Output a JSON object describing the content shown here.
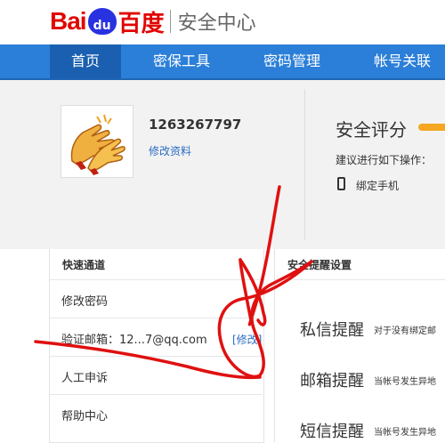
{
  "header": {
    "logo_left": "Bai",
    "logo_paw": "du",
    "logo_cn": "百度",
    "subtitle": "安全中心"
  },
  "nav": {
    "items": [
      "首页",
      "密保工具",
      "密码管理",
      "帐号关联"
    ]
  },
  "profile": {
    "username": "1263267797",
    "edit_link": "修改资料"
  },
  "security": {
    "title": "安全评分",
    "suggestion": "建议进行如下操作：",
    "bind_phone": "绑定手机"
  },
  "quick": {
    "title": "快速通道",
    "items": [
      "修改密码",
      "验证邮箱：12...7@qq.com",
      "人工申诉",
      "帮助中心"
    ],
    "modify_link": "[修改]"
  },
  "alerts": {
    "title": "安全提醒设置",
    "items": [
      {
        "name": "私信提醒",
        "desc": "对于没有绑定邮"
      },
      {
        "name": "邮箱提醒",
        "desc": "当帐号发生异地"
      },
      {
        "name": "短信提醒",
        "desc": "当帐号发生异地"
      }
    ]
  },
  "colors": {
    "nav_bg": "#2b7fd8",
    "nav_active": "#1a5fb0",
    "brand_red": "#e10602",
    "brand_blue": "#2932e1",
    "link": "#2b6cc4",
    "score_bar": "#f5a623",
    "scribble": "#e01010"
  }
}
